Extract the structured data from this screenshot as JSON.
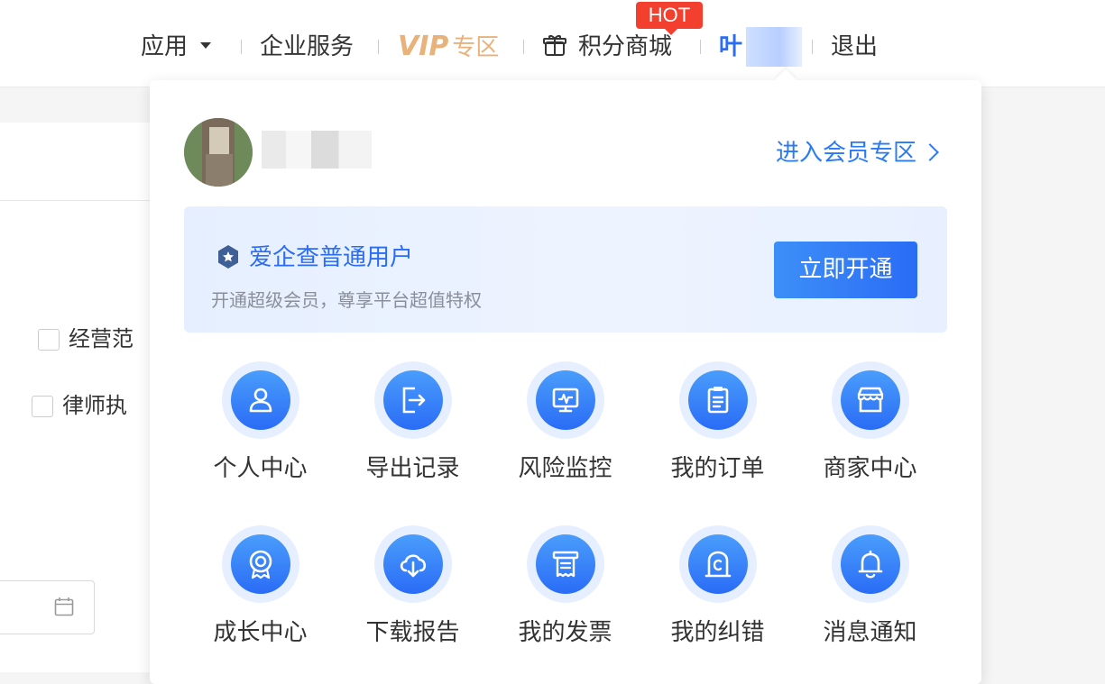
{
  "nav": {
    "apps": "应用",
    "enterprise": "企业服务",
    "vip_logo": "VIP",
    "vip_zone": "专区",
    "points_mall": "积分商城",
    "hot_badge": "HOT",
    "user_name": "叶",
    "logout": "退出"
  },
  "background": {
    "checkbox_1": "经营范",
    "checkbox_2": "律师执"
  },
  "dropdown": {
    "enter_member_zone": "进入会员专区",
    "member_title": "爱企查普通用户",
    "member_subtitle": "开通超级会员，尊享平台超值特权",
    "open_button": "立即开通",
    "items": [
      {
        "label": "个人中心",
        "icon": "person-icon"
      },
      {
        "label": "导出记录",
        "icon": "export-icon"
      },
      {
        "label": "风险监控",
        "icon": "monitor-icon"
      },
      {
        "label": "我的订单",
        "icon": "clipboard-icon"
      },
      {
        "label": "商家中心",
        "icon": "store-icon"
      },
      {
        "label": "成长中心",
        "icon": "medal-icon"
      },
      {
        "label": "下载报告",
        "icon": "cloud-download-icon"
      },
      {
        "label": "我的发票",
        "icon": "receipt-icon"
      },
      {
        "label": "我的纠错",
        "icon": "correction-icon"
      },
      {
        "label": "消息通知",
        "icon": "bell-icon"
      }
    ]
  },
  "colors": {
    "accent": "#2a6cf6",
    "vip_gold": "#e8b27a",
    "hot_red": "#f23f2e"
  }
}
